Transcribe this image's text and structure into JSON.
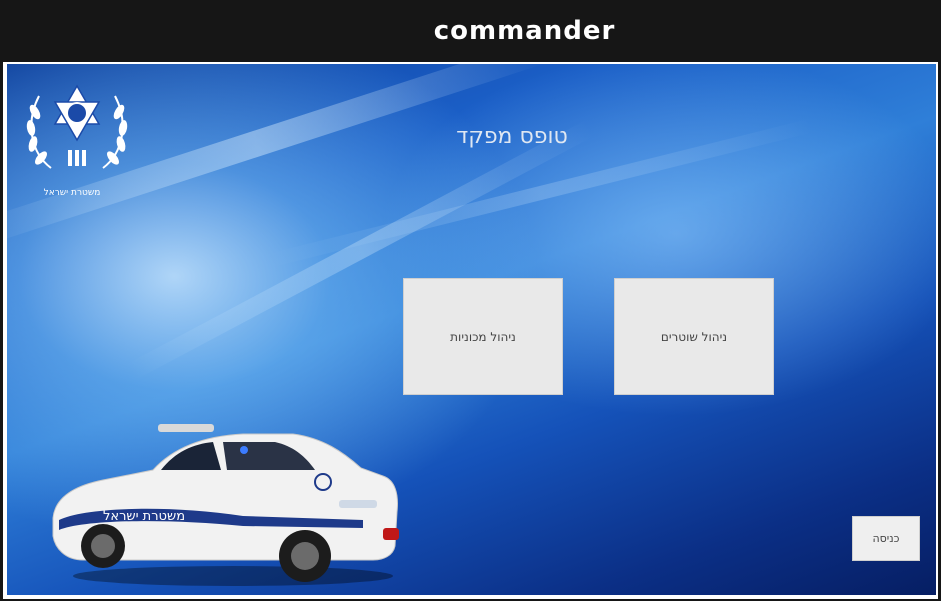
{
  "window": {
    "title": "commander"
  },
  "page": {
    "title": "טופס מפקד"
  },
  "logo": {
    "caption": "משטרת ישראל",
    "icon": "police-emblem-icon"
  },
  "tiles": [
    {
      "label": "ניהול מכוניות"
    },
    {
      "label": "ניהול שוטרים"
    }
  ],
  "logout": {
    "label": "כניסה"
  },
  "car": {
    "side_text": "משטרת ישראל"
  },
  "colors": {
    "background_dark": "#0b2f86",
    "background_light": "#8fc6f2",
    "tile": "#e9e9e9",
    "titlebar": "#161616"
  }
}
